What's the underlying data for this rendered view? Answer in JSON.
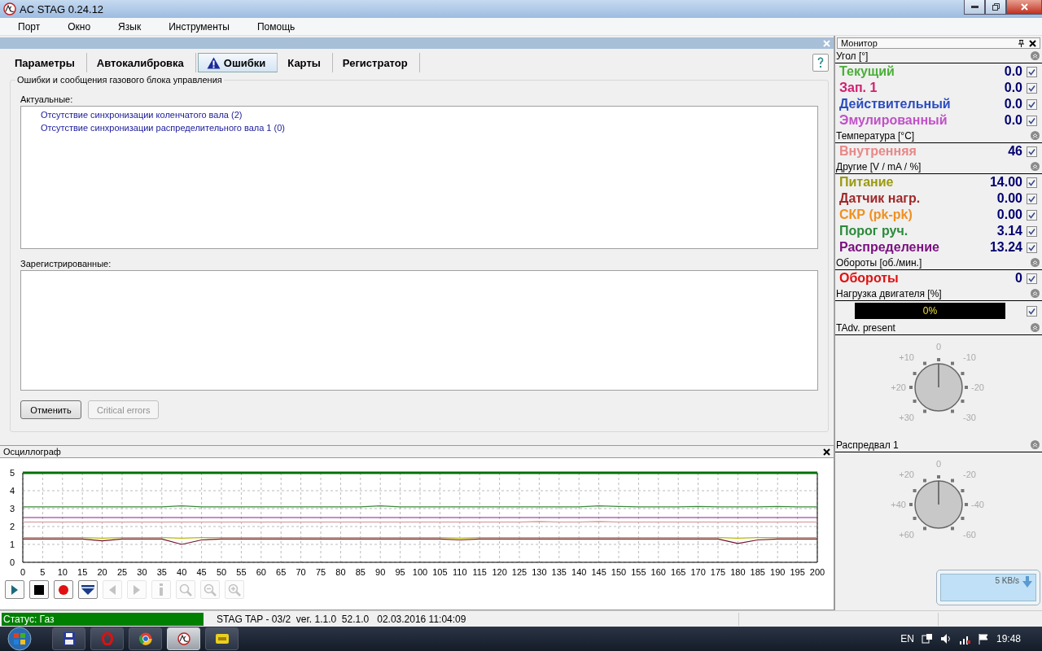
{
  "window": {
    "title": "AC STAG 0.24.12"
  },
  "menu": [
    "Порт",
    "Окно",
    "Язык",
    "Инструменты",
    "Помощь"
  ],
  "tabs": [
    {
      "label": "Параметры",
      "selected": false,
      "warning": false
    },
    {
      "label": "Автокалибровка",
      "selected": false,
      "warning": false
    },
    {
      "label": "Ошибки",
      "selected": true,
      "warning": true
    },
    {
      "label": "Карты",
      "selected": false,
      "warning": false
    },
    {
      "label": "Регистратор",
      "selected": false,
      "warning": false
    }
  ],
  "errors": {
    "group_title": "Ошибки и сообщения газового блока управления",
    "current_label": "Актуальные:",
    "current": [
      "Отсутствие синхронизации коленчатого вала (2)",
      "Отсутствие синхронизации распределительного вала 1 (0)"
    ],
    "registered_label": "Зарегистрированные:",
    "buttons": [
      {
        "label": "Отменить",
        "disabled": false
      },
      {
        "label": "Critical errors",
        "disabled": true
      }
    ]
  },
  "oscilloscope": {
    "title": "Осциллограф",
    "chart_data": {
      "type": "line",
      "x": [
        0,
        5,
        10,
        15,
        20,
        25,
        30,
        35,
        40,
        45,
        50,
        55,
        60,
        65,
        70,
        75,
        80,
        85,
        90,
        95,
        100,
        105,
        110,
        115,
        120,
        125,
        130,
        135,
        140,
        145,
        150,
        155,
        160,
        165,
        170,
        175,
        180,
        185,
        190,
        195,
        200
      ],
      "series": [
        {
          "color": "#007000",
          "values": [
            5,
            5,
            5,
            5,
            5,
            5,
            5,
            5,
            5,
            5,
            5,
            5,
            5,
            5,
            5,
            5,
            5,
            5,
            5,
            5,
            5,
            5,
            5,
            5,
            5,
            5,
            5,
            5,
            5,
            5,
            5,
            5,
            5,
            5,
            5,
            5,
            5,
            5,
            5,
            5,
            5
          ]
        },
        {
          "color": "#3a8a3a",
          "values": [
            3.1,
            3.1,
            3.1,
            3.1,
            3.1,
            3.1,
            3.1,
            3.1,
            3.15,
            3.1,
            3.1,
            3.1,
            3.1,
            3.1,
            3.1,
            3.1,
            3.1,
            3.1,
            3.15,
            3.1,
            3.1,
            3.1,
            3.1,
            3.1,
            3.1,
            3.1,
            3.1,
            3.1,
            3.1,
            3.15,
            3.12,
            3.1,
            3.1,
            3.1,
            3.12,
            3.1,
            3.1,
            3.1,
            3.12,
            3.1,
            3.1
          ]
        },
        {
          "color": "#8b1a8b",
          "values": [
            2.5,
            2.5,
            2.5,
            2.5,
            2.5,
            2.5,
            2.5,
            2.5,
            2.5,
            2.5,
            2.5,
            2.5,
            2.5,
            2.5,
            2.5,
            2.5,
            2.5,
            2.5,
            2.5,
            2.5,
            2.5,
            2.5,
            2.5,
            2.5,
            2.5,
            2.5,
            2.5,
            2.5,
            2.5,
            2.5,
            2.5,
            2.5,
            2.5,
            2.5,
            2.5,
            2.5,
            2.5,
            2.5,
            2.5,
            2.5,
            2.5
          ]
        },
        {
          "color": "#d09090",
          "values": [
            2.25,
            2.25,
            2.25,
            2.25,
            2.25,
            2.25,
            2.25,
            2.25,
            2.25,
            2.25,
            2.25,
            2.25,
            2.25,
            2.25,
            2.25,
            2.25,
            2.25,
            2.25,
            2.25,
            2.25,
            2.25,
            2.25,
            2.25,
            2.25,
            2.25,
            2.25,
            2.28,
            2.25,
            2.25,
            2.28,
            2.25,
            2.25,
            2.25,
            2.25,
            2.25,
            2.25,
            2.25,
            2.25,
            2.25,
            2.25,
            2.25
          ]
        },
        {
          "color": "#b8b800",
          "values": [
            1.38,
            1.38,
            1.38,
            1.38,
            1.35,
            1.38,
            1.38,
            1.38,
            1.35,
            1.38,
            1.38,
            1.38,
            1.38,
            1.38,
            1.38,
            1.38,
            1.38,
            1.38,
            1.38,
            1.38,
            1.38,
            1.38,
            1.35,
            1.38,
            1.38,
            1.38,
            1.38,
            1.38,
            1.38,
            1.38,
            1.38,
            1.38,
            1.38,
            1.38,
            1.38,
            1.38,
            1.35,
            1.38,
            1.38,
            1.38,
            1.38
          ]
        },
        {
          "color": "#701030",
          "values": [
            1.3,
            1.3,
            1.3,
            1.3,
            1.2,
            1.3,
            1.3,
            1.3,
            1.0,
            1.25,
            1.3,
            1.3,
            1.3,
            1.3,
            1.3,
            1.3,
            1.3,
            1.3,
            1.3,
            1.3,
            1.3,
            1.3,
            1.25,
            1.3,
            1.3,
            1.3,
            1.3,
            1.3,
            1.3,
            1.3,
            1.3,
            1.3,
            1.3,
            1.3,
            1.3,
            1.3,
            1.05,
            1.25,
            1.3,
            1.3,
            1.3
          ]
        }
      ],
      "xlim": [
        0,
        200
      ],
      "ylim": [
        0,
        5
      ],
      "grid": true,
      "xticks": [
        0,
        5,
        10,
        15,
        20,
        25,
        30,
        35,
        40,
        45,
        50,
        55,
        60,
        65,
        70,
        75,
        80,
        85,
        90,
        95,
        100,
        105,
        110,
        115,
        120,
        125,
        130,
        135,
        140,
        145,
        150,
        155,
        160,
        165,
        170,
        175,
        180,
        185,
        190,
        195,
        200
      ],
      "yticks": [
        0,
        1,
        2,
        3,
        4,
        5
      ]
    },
    "toolbar": [
      {
        "kind": "play",
        "disabled": false
      },
      {
        "kind": "stop",
        "disabled": false
      },
      {
        "kind": "record",
        "disabled": false
      },
      {
        "kind": "download",
        "disabled": false
      },
      {
        "kind": "prev",
        "disabled": true
      },
      {
        "kind": "next",
        "disabled": true
      },
      {
        "kind": "info",
        "disabled": true
      },
      {
        "kind": "search",
        "disabled": true
      },
      {
        "kind": "zoom_out",
        "disabled": true
      },
      {
        "kind": "zoom_in",
        "disabled": true
      }
    ]
  },
  "monitor": {
    "title": "Монитор",
    "sections": [
      {
        "title": "Угол [°]",
        "kind": "rows",
        "rows": [
          {
            "label": "Текущий",
            "value": "0.0",
            "color": "#4caf3a",
            "checked": true
          },
          {
            "label": "Зап. 1",
            "value": "0.0",
            "color": "#d02070",
            "checked": true
          },
          {
            "label": "Действительный",
            "value": "0.0",
            "color": "#2a4cc0",
            "checked": true
          },
          {
            "label": "Эмулированный",
            "value": "0.0",
            "color": "#c050c8",
            "checked": true
          }
        ]
      },
      {
        "title": "Температура [°C]",
        "kind": "rows",
        "rows": [
          {
            "label": "Внутренняя",
            "value": "46",
            "color": "#e88888",
            "checked": true
          }
        ]
      },
      {
        "title": "Другие [V / mA / %]",
        "kind": "rows",
        "rows": [
          {
            "label": "Питание",
            "value": "14.00",
            "color": "#9a9a10",
            "checked": true
          },
          {
            "label": "Датчик нагр.",
            "value": "0.00",
            "color": "#a02828",
            "checked": true
          },
          {
            "label": "СКР (pk-pk)",
            "value": "0.00",
            "color": "#f09020",
            "checked": true
          },
          {
            "label": "Порог руч.",
            "value": "3.14",
            "color": "#2a8a3a",
            "checked": true
          },
          {
            "label": "Распределение",
            "value": "13.24",
            "color": "#7a1080",
            "checked": true
          }
        ]
      },
      {
        "title": "Обороты [об./мин.]",
        "kind": "rows",
        "rows": [
          {
            "label": "Обороты",
            "value": "0",
            "color": "#e01010",
            "checked": true
          }
        ]
      },
      {
        "title": "Нагрузка двигателя [%]",
        "kind": "bar",
        "level": 0,
        "reading": "0%",
        "checked": true
      },
      {
        "title": "TAdv. present",
        "kind": "dial",
        "labels": [
          "0",
          "+10",
          "-10",
          "+20",
          "-20",
          "+30",
          "-30"
        ]
      },
      {
        "title": "Распредвал 1",
        "kind": "dial",
        "labels": [
          "0",
          "+20",
          "-20",
          "+40",
          "-40",
          "+60",
          "-60"
        ]
      }
    ]
  },
  "tray_popup": {
    "speed": "5 KB/s"
  },
  "status_bar": {
    "status": "Статус: Газ",
    "device": "STAG TAP - 03/2",
    "version": "ver. 1.1.0",
    "code": "52.1.0",
    "datetime": "02.03.2016 11:04:09"
  },
  "taskbar": {
    "language": "EN",
    "time": "19:48"
  }
}
